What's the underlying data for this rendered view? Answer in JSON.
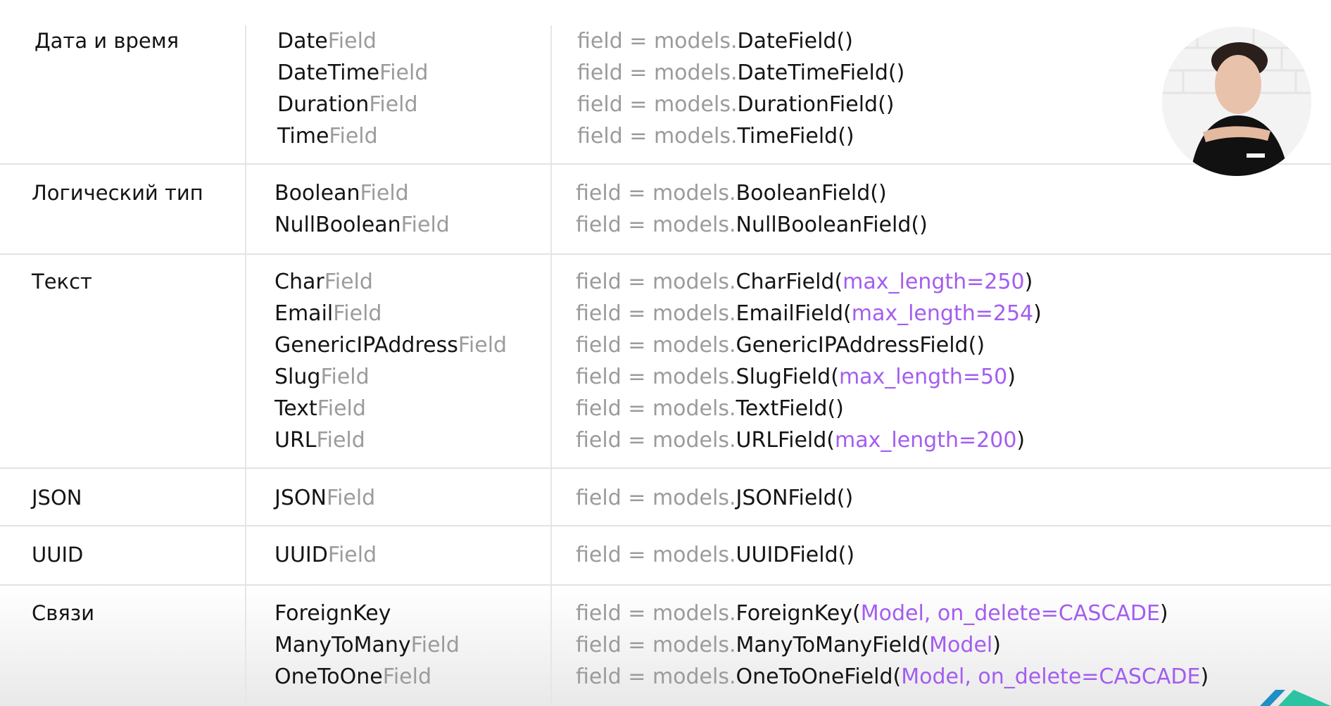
{
  "sections": [
    {
      "category": "Дата и время",
      "fields": [
        {
          "base": "Date",
          "suffix": "Field"
        },
        {
          "base": "DateTime",
          "suffix": "Field"
        },
        {
          "base": "Duration",
          "suffix": "Field"
        },
        {
          "base": "Time",
          "suffix": "Field"
        }
      ],
      "code": [
        {
          "prefix": "field = models.",
          "name": "DateField",
          "args": "",
          "paren_open": "(",
          "paren_close": ")"
        },
        {
          "prefix": "field = models.",
          "name": "DateTimeField",
          "args": "",
          "paren_open": "(",
          "paren_close": ")"
        },
        {
          "prefix": "field = models.",
          "name": "DurationField",
          "args": "",
          "paren_open": "(",
          "paren_close": ")"
        },
        {
          "prefix": "field = models.",
          "name": "TimeField",
          "args": "",
          "paren_open": "(",
          "paren_close": ")"
        }
      ]
    },
    {
      "category": "Логический тип",
      "fields": [
        {
          "base": "Boolean",
          "suffix": "Field"
        },
        {
          "base": "NullBoolean",
          "suffix": "Field"
        }
      ],
      "code": [
        {
          "prefix": "field = models.",
          "name": "BooleanField",
          "args": "",
          "paren_open": "(",
          "paren_close": ")"
        },
        {
          "prefix": "field = models.",
          "name": "NullBooleanField",
          "args": "",
          "paren_open": "(",
          "paren_close": ")"
        }
      ]
    },
    {
      "category": "Текст",
      "fields": [
        {
          "base": "Char",
          "suffix": "Field"
        },
        {
          "base": "Email",
          "suffix": "Field"
        },
        {
          "base": "GenericIPAddress",
          "suffix": "Field"
        },
        {
          "base": "Slug",
          "suffix": "Field"
        },
        {
          "base": "Text",
          "suffix": "Field"
        },
        {
          "base": "URL",
          "suffix": "Field"
        }
      ],
      "code": [
        {
          "prefix": "field = models.",
          "name": "CharField",
          "args": "max_length=250",
          "paren_open": "(",
          "paren_close": ")"
        },
        {
          "prefix": "field = models.",
          "name": "EmailField",
          "args": "max_length=254",
          "paren_open": "(",
          "paren_close": ")"
        },
        {
          "prefix": "field = models.",
          "name": "GenericIPAddressField",
          "args": "",
          "paren_open": "(",
          "paren_close": ")"
        },
        {
          "prefix": "field = models.",
          "name": "SlugField",
          "args": "max_length=50",
          "paren_open": "(",
          "paren_close": ")"
        },
        {
          "prefix": "field = models.",
          "name": "TextField",
          "args": "",
          "paren_open": "(",
          "paren_close": ")"
        },
        {
          "prefix": "field = models.",
          "name": "URLField",
          "args": "max_length=200",
          "paren_open": "(",
          "paren_close": ")"
        }
      ]
    },
    {
      "category": "JSON",
      "fields": [
        {
          "base": "JSON",
          "suffix": "Field"
        }
      ],
      "code": [
        {
          "prefix": "field = models.",
          "name": "JSONField",
          "args": "",
          "paren_open": "(",
          "paren_close": ")"
        }
      ]
    },
    {
      "category": "UUID",
      "fields": [
        {
          "base": "UUID",
          "suffix": "Field"
        }
      ],
      "code": [
        {
          "prefix": "field = models.",
          "name": "UUIDField",
          "args": "",
          "paren_open": "(",
          "paren_close": ")"
        }
      ]
    },
    {
      "category": "Связи",
      "fields": [
        {
          "base": "ForeignKey",
          "suffix": ""
        },
        {
          "base": "ManyToMany",
          "suffix": "Field"
        },
        {
          "base": "OneToOne",
          "suffix": "Field"
        }
      ],
      "code": [
        {
          "prefix": "field = models.",
          "name": "ForeignKey",
          "args": "Model, on_delete=CASCADE",
          "paren_open": "(",
          "paren_close": ")"
        },
        {
          "prefix": "field = models.",
          "name": "ManyToManyField",
          "args": "Model",
          "paren_open": "(",
          "paren_close": ")"
        },
        {
          "prefix": "field = models.",
          "name": "OneToOneField",
          "args": "Model, on_delete=CASCADE",
          "paren_open": "(",
          "paren_close": ")"
        }
      ]
    }
  ],
  "colors": {
    "text": "#141414",
    "muted": "#9b9b9b",
    "accent": "#a35df0",
    "grid": "#e3e3e3"
  },
  "overlays": {
    "webcam": "presenter-webcam",
    "logo": "brand-logo-icon"
  }
}
